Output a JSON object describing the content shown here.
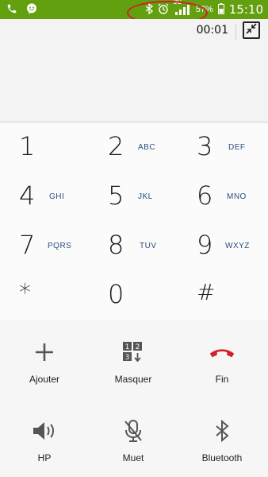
{
  "statusbar": {
    "network": "3G",
    "battery_percent": "57%",
    "time": "15:10"
  },
  "call": {
    "timer": "00:01"
  },
  "keypad": {
    "keys": [
      {
        "digit": "1",
        "letters": ""
      },
      {
        "digit": "2",
        "letters": "ABC"
      },
      {
        "digit": "3",
        "letters": "DEF"
      },
      {
        "digit": "4",
        "letters": "GHI"
      },
      {
        "digit": "5",
        "letters": "JKL"
      },
      {
        "digit": "6",
        "letters": "MNO"
      },
      {
        "digit": "7",
        "letters": "PQRS"
      },
      {
        "digit": "8",
        "letters": "TUV"
      },
      {
        "digit": "9",
        "letters": "WXYZ"
      },
      {
        "digit": "*",
        "letters": ""
      },
      {
        "digit": "0",
        "letters": ""
      },
      {
        "digit": "#",
        "letters": ""
      }
    ]
  },
  "actions": {
    "add": "Ajouter",
    "hide": "Masquer",
    "end": "Fin",
    "speaker": "HP",
    "mute": "Muet",
    "bluetooth": "Bluetooth"
  },
  "colors": {
    "statusbar": "#63a00f",
    "end_call": "#d0202a",
    "letters": "#2a4d7a",
    "annotation": "#d0202a"
  }
}
